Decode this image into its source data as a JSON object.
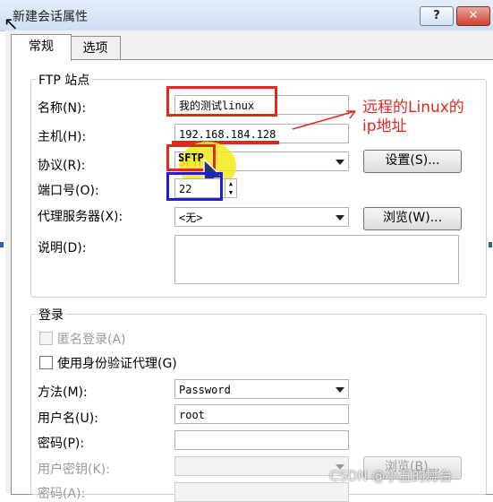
{
  "window": {
    "title": "新建会话属性",
    "help_btn": "?",
    "close_btn": "✕"
  },
  "tabs": [
    {
      "label": "常规"
    },
    {
      "label": "选项"
    }
  ],
  "ftp": {
    "group_title": "FTP 站点",
    "name_label": "名称(N):",
    "name_value": "我的测试linux",
    "host_label": "主机(H):",
    "host_value": "192.168.184.128",
    "protocol_label": "协议(R):",
    "protocol_value": "SFTP",
    "settings_btn": "设置(S)...",
    "port_label": "端口号(O):",
    "port_value": "22",
    "proxy_label": "代理服务器(X):",
    "proxy_value": "<无>",
    "browse_btn": "浏览(W)...",
    "desc_label": "说明(D):"
  },
  "login": {
    "group_title": "登录",
    "anonymous_label": "匿名登录(A)",
    "agent_label": "使用身份验证代理(G)",
    "method_label": "方法(M):",
    "method_value": "Password",
    "user_label": "用户名(U):",
    "user_value": "root",
    "password_label": "密码(P):",
    "userkey_label": "用户密钥(K):",
    "browse_btn": "浏览(B)...",
    "passphrase_label": "密码(A):"
  },
  "annotation": {
    "line1": "远程的Linux的",
    "line2": "ip地址"
  },
  "watermark": "CSDN @小丑的舞台",
  "colors": {
    "highlight_red": "#e0291c",
    "highlight_blue": "#1f1fd1",
    "highlight_yellow": "#f3ea1c"
  }
}
